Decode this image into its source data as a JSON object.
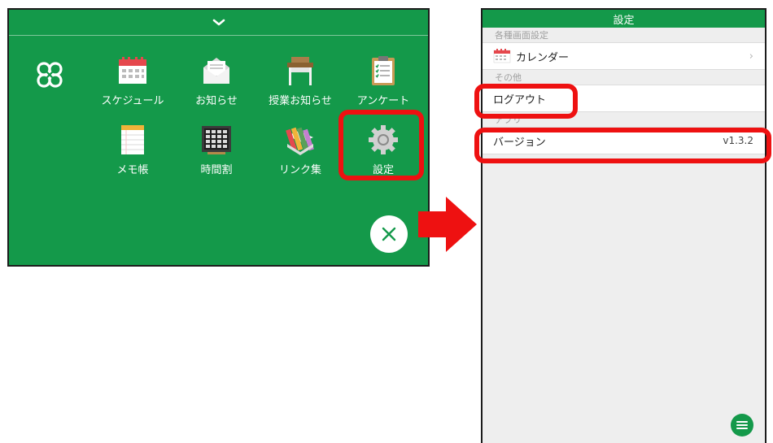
{
  "menu": {
    "collapse_icon": "chevron-down-icon",
    "logo": "app-logo-icon",
    "tiles": [
      {
        "label": "スケジュール",
        "icon": "calendar-icon"
      },
      {
        "label": "お知らせ",
        "icon": "envelope-icon"
      },
      {
        "label": "授業お知らせ",
        "icon": "school-desk-icon"
      },
      {
        "label": "アンケート",
        "icon": "clipboard-icon"
      },
      {
        "label": "メモ帳",
        "icon": "notepad-icon"
      },
      {
        "label": "時間割",
        "icon": "timetable-icon"
      },
      {
        "label": "リンク集",
        "icon": "books-icon"
      },
      {
        "label": "設定",
        "icon": "gear-icon"
      }
    ],
    "close_icon": "close-icon"
  },
  "settings": {
    "title": "設定",
    "sections": [
      {
        "header": "各種画面設定",
        "rows": [
          {
            "label": "カレンダー",
            "icon": "calendar-icon",
            "trailing": "›"
          }
        ]
      },
      {
        "header": "その他",
        "rows": [
          {
            "label": "ログアウト"
          }
        ]
      },
      {
        "header": "アプリ",
        "rows": [
          {
            "label": "バージョン",
            "value": "v1.3.2"
          }
        ]
      }
    ],
    "fab_icon": "menu-icon"
  },
  "colors": {
    "brand_green": "#14994a",
    "highlight_red": "#ee1111",
    "background": "#eeeeee"
  }
}
